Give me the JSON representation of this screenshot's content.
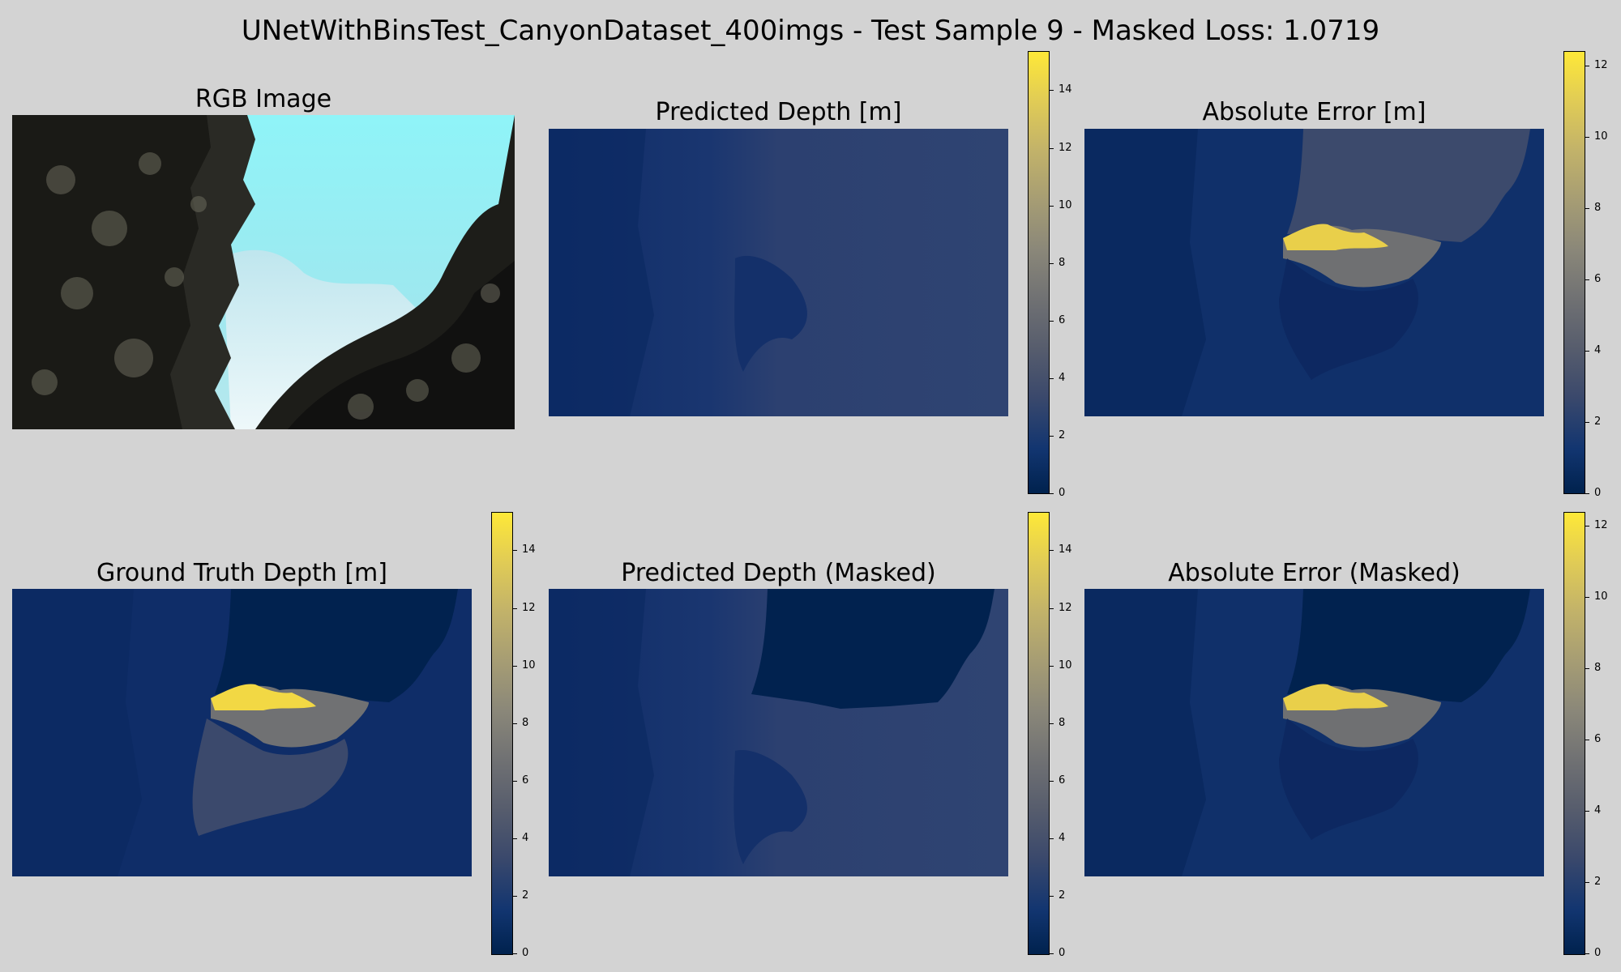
{
  "figure": {
    "title": "UNetWithBinsTest_CanyonDataset_400imgs - Test Sample 9 - Masked Loss: 1.0719"
  },
  "panels": {
    "rgb": {
      "title": "RGB Image"
    },
    "pred": {
      "title": "Predicted Depth [m]"
    },
    "err": {
      "title": "Absolute Error [m]"
    },
    "gt": {
      "title": "Ground Truth Depth [m]"
    },
    "pred_masked": {
      "title": "Predicted Depth (Masked)"
    },
    "err_masked": {
      "title": "Absolute Error (Masked)"
    }
  },
  "colorbars": {
    "colormap": "cividis",
    "colors": [
      "#00224e",
      "#123570",
      "#3b496c",
      "#575d6d",
      "#707173",
      "#8a8779",
      "#a59c74",
      "#c3b369",
      "#e1cc55",
      "#fee838"
    ],
    "depth": {
      "min": 0,
      "max": 15.3,
      "ticks": [
        "0",
        "2",
        "4",
        "6",
        "8",
        "10",
        "12",
        "14"
      ]
    },
    "error": {
      "min": 0,
      "max": 12.4,
      "ticks": [
        "0",
        "2",
        "4",
        "6",
        "8",
        "10",
        "12"
      ]
    }
  }
}
